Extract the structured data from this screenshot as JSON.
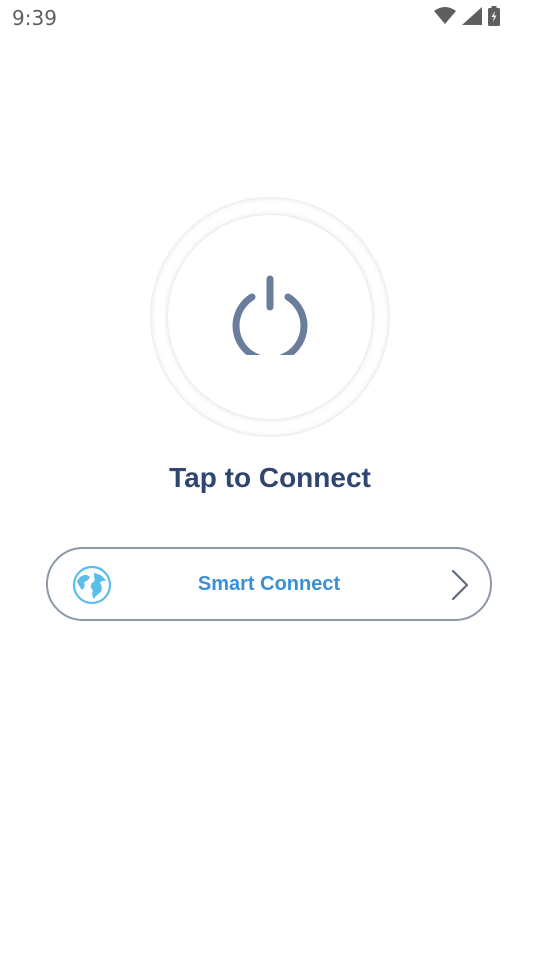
{
  "status_bar": {
    "time": "9:39"
  },
  "power": {
    "icon": "power-icon",
    "label": "Tap to Connect"
  },
  "smart_connect": {
    "label": "Smart Connect",
    "icon": "globe-icon",
    "chevron": "chevron-right-icon"
  },
  "colors": {
    "title": "#2f4670",
    "accent": "#3a8fd6",
    "power_icon": "#6a7d9c",
    "button_border": "#8c97a8"
  }
}
